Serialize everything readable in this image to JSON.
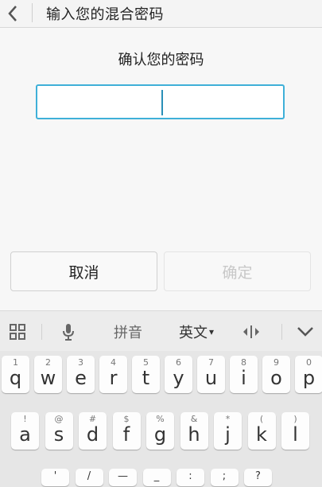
{
  "header": {
    "title": "输入您的混合密码"
  },
  "main": {
    "subtitle": "确认您的密码",
    "cancel_label": "取消",
    "confirm_label": "确定"
  },
  "keyboard": {
    "toolbar": {
      "pinyin": "拼音",
      "english": "英文",
      "english_arrow": "▾"
    },
    "row1": [
      {
        "num": "1",
        "letter": "q"
      },
      {
        "num": "2",
        "letter": "w"
      },
      {
        "num": "3",
        "letter": "e"
      },
      {
        "num": "4",
        "letter": "r"
      },
      {
        "num": "5",
        "letter": "t"
      },
      {
        "num": "6",
        "letter": "y"
      },
      {
        "num": "7",
        "letter": "u"
      },
      {
        "num": "8",
        "letter": "i"
      },
      {
        "num": "9",
        "letter": "o"
      },
      {
        "num": "0",
        "letter": "p"
      }
    ],
    "row2": [
      {
        "num": "!",
        "letter": "a"
      },
      {
        "num": "@",
        "letter": "s"
      },
      {
        "num": "#",
        "letter": "d"
      },
      {
        "num": "$",
        "letter": "f"
      },
      {
        "num": "%",
        "letter": "g"
      },
      {
        "num": "&",
        "letter": "h"
      },
      {
        "num": "*",
        "letter": "j"
      },
      {
        "num": "(",
        "letter": "k"
      },
      {
        "num": ")",
        "letter": "l"
      }
    ],
    "row3": [
      "'",
      "/",
      "—",
      "_",
      ":",
      ";",
      "?"
    ]
  }
}
